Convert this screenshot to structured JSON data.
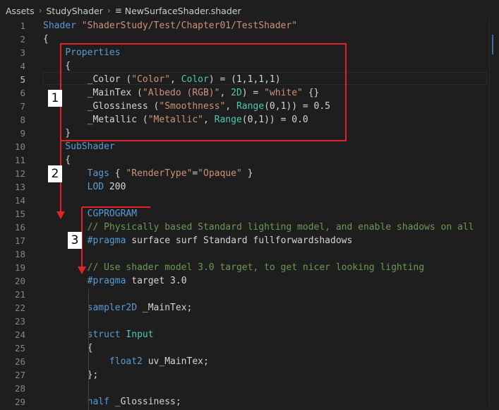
{
  "breadcrumb": {
    "items": [
      "Assets",
      "StudyShader",
      "NewSurfaceShader.shader"
    ],
    "file_icon": "lines-icon"
  },
  "editor": {
    "active_line": 5,
    "lines": [
      {
        "n": "1",
        "tokens": [
          [
            "kw",
            "Shader"
          ],
          [
            "pl",
            " "
          ],
          [
            "str",
            "\"ShaderStudy/Test/Chapter01/TestShader\""
          ]
        ]
      },
      {
        "n": "2",
        "tokens": [
          [
            "pl",
            "{"
          ]
        ]
      },
      {
        "n": "3",
        "tokens": [
          [
            "pl",
            "    "
          ],
          [
            "kw",
            "Properties"
          ]
        ]
      },
      {
        "n": "4",
        "tokens": [
          [
            "pl",
            "    {"
          ]
        ]
      },
      {
        "n": "5",
        "tokens": [
          [
            "pl",
            "        _Color ("
          ],
          [
            "str",
            "\"Color\""
          ],
          [
            "pl",
            ", "
          ],
          [
            "ty",
            "Color"
          ],
          [
            "pl",
            ") = (1,1,1,1)"
          ]
        ]
      },
      {
        "n": "6",
        "tokens": [
          [
            "pl",
            "        _MainTex ("
          ],
          [
            "str",
            "\"Albedo (RGB)\""
          ],
          [
            "pl",
            ", "
          ],
          [
            "ty",
            "2D"
          ],
          [
            "pl",
            ") = "
          ],
          [
            "str",
            "\"white\""
          ],
          [
            "pl",
            " {}"
          ]
        ]
      },
      {
        "n": "7",
        "tokens": [
          [
            "pl",
            "        _Glossiness ("
          ],
          [
            "str",
            "\"Smoothness\""
          ],
          [
            "pl",
            ", "
          ],
          [
            "ty",
            "Range"
          ],
          [
            "pl",
            "(0,1)) = 0.5"
          ]
        ]
      },
      {
        "n": "8",
        "tokens": [
          [
            "pl",
            "        _Metallic ("
          ],
          [
            "str",
            "\"Metallic\""
          ],
          [
            "pl",
            ", "
          ],
          [
            "ty",
            "Range"
          ],
          [
            "pl",
            "(0,1)) = 0.0"
          ]
        ]
      },
      {
        "n": "9",
        "tokens": [
          [
            "pl",
            "    }"
          ]
        ]
      },
      {
        "n": "10",
        "tokens": [
          [
            "pl",
            "    "
          ],
          [
            "kw",
            "SubShader"
          ]
        ]
      },
      {
        "n": "11",
        "tokens": [
          [
            "pl",
            "    {"
          ]
        ]
      },
      {
        "n": "12",
        "tokens": [
          [
            "pl",
            "        "
          ],
          [
            "kw",
            "Tags"
          ],
          [
            "pl",
            " { "
          ],
          [
            "str",
            "\"RenderType\""
          ],
          [
            "pl",
            "="
          ],
          [
            "str",
            "\"Opaque\""
          ],
          [
            "pl",
            " }"
          ]
        ]
      },
      {
        "n": "13",
        "tokens": [
          [
            "pl",
            "        "
          ],
          [
            "kw",
            "LOD"
          ],
          [
            "pl",
            " 200"
          ]
        ]
      },
      {
        "n": "14",
        "tokens": []
      },
      {
        "n": "15",
        "tokens": [
          [
            "pl",
            "        "
          ],
          [
            "kw",
            "CGPROGRAM"
          ]
        ]
      },
      {
        "n": "16",
        "tokens": [
          [
            "pl",
            "        "
          ],
          [
            "cm",
            "// Physically based Standard lighting model, and enable shadows on all"
          ]
        ]
      },
      {
        "n": "17",
        "tokens": [
          [
            "pl",
            "        "
          ],
          [
            "kw",
            "#pragma"
          ],
          [
            "pl",
            " surface surf Standard fullforwardshadows"
          ]
        ]
      },
      {
        "n": "18",
        "tokens": []
      },
      {
        "n": "19",
        "tokens": [
          [
            "pl",
            "        "
          ],
          [
            "cm",
            "// Use shader model 3.0 target, to get nicer looking lighting"
          ]
        ]
      },
      {
        "n": "20",
        "tokens": [
          [
            "pl",
            "        "
          ],
          [
            "kw",
            "#pragma"
          ],
          [
            "pl",
            " target 3.0"
          ]
        ]
      },
      {
        "n": "21",
        "tokens": []
      },
      {
        "n": "22",
        "tokens": [
          [
            "pl",
            "        "
          ],
          [
            "kw",
            "sampler2D"
          ],
          [
            "pl",
            " _MainTex;"
          ]
        ]
      },
      {
        "n": "23",
        "tokens": []
      },
      {
        "n": "24",
        "tokens": [
          [
            "pl",
            "        "
          ],
          [
            "kw",
            "struct"
          ],
          [
            "pl",
            " "
          ],
          [
            "ty",
            "Input"
          ]
        ]
      },
      {
        "n": "25",
        "tokens": [
          [
            "pl",
            "        {"
          ]
        ]
      },
      {
        "n": "26",
        "tokens": [
          [
            "pl",
            "            "
          ],
          [
            "kw",
            "float2"
          ],
          [
            "pl",
            " uv_MainTex;"
          ]
        ]
      },
      {
        "n": "27",
        "tokens": [
          [
            "pl",
            "        };"
          ]
        ]
      },
      {
        "n": "28",
        "tokens": []
      },
      {
        "n": "29",
        "tokens": [
          [
            "pl",
            "        "
          ],
          [
            "kw",
            "half"
          ],
          [
            "pl",
            " _Glossiness;"
          ]
        ]
      }
    ]
  },
  "annotations": {
    "labels": [
      "1",
      "2",
      "3"
    ],
    "color": "#e1242a"
  },
  "colors": {
    "background": "#1e1e1e",
    "keyword": "#569cd6",
    "string": "#ce9178",
    "type": "#4ec9b0",
    "comment": "#6a9955",
    "text": "#d4d4d4",
    "line_number": "#858585"
  }
}
